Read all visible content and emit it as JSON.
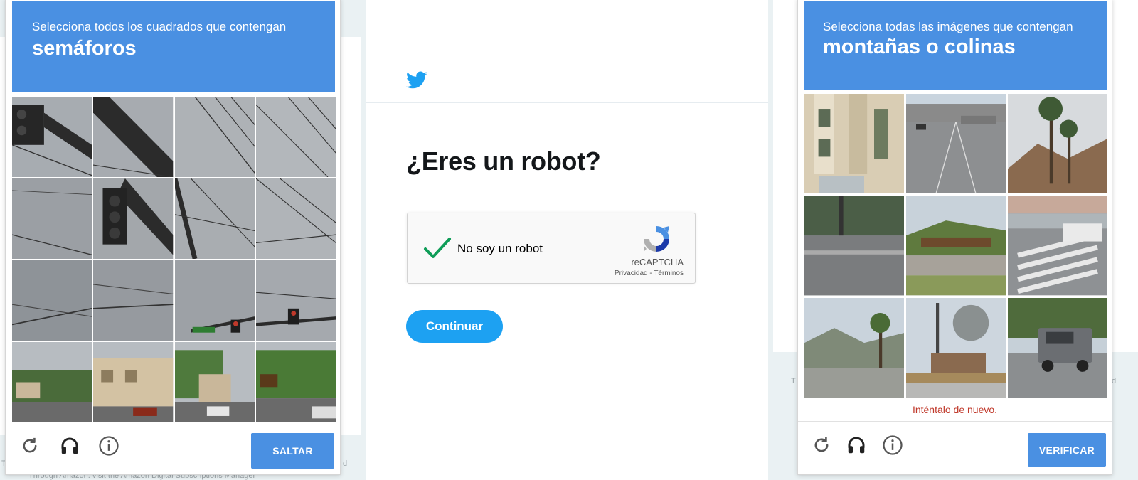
{
  "left_captcha": {
    "instruction_lead": "Selecciona todos los cuadrados que contengan",
    "instruction_target": "semáforos",
    "grid": "4x4",
    "tools": [
      "reload-icon",
      "headphones-icon",
      "info-icon"
    ],
    "action_label": "SALTAR"
  },
  "middle": {
    "logo_icon": "twitter-bird-icon",
    "heading": "¿Eres un robot?",
    "recaptcha": {
      "checked": true,
      "label": "No soy un robot",
      "brand": "reCAPTCHA",
      "terms": "Privacidad - Términos"
    },
    "continue_label": "Continuar"
  },
  "right_captcha": {
    "instruction_lead": "Selecciona todas las imágenes que contengan",
    "instruction_target": "montañas o colinas",
    "grid": "3x3",
    "error": "Inténtalo de nuevo.",
    "tools": [
      "reload-icon",
      "headphones-icon",
      "info-icon"
    ],
    "action_label": "VERIFICAR"
  },
  "background_fragments": {
    "left_bottom_text": "Tnrough Amazon. visit the Amazon Digital Subscriptions Manager",
    "left_t": "T",
    "left_d": "d",
    "right_t": "T",
    "right_d": "d"
  },
  "colors": {
    "captcha_header": "#4a90e2",
    "twitter_blue": "#1da1f2",
    "error_red": "#c0392b",
    "check_green": "#0f9d58"
  }
}
